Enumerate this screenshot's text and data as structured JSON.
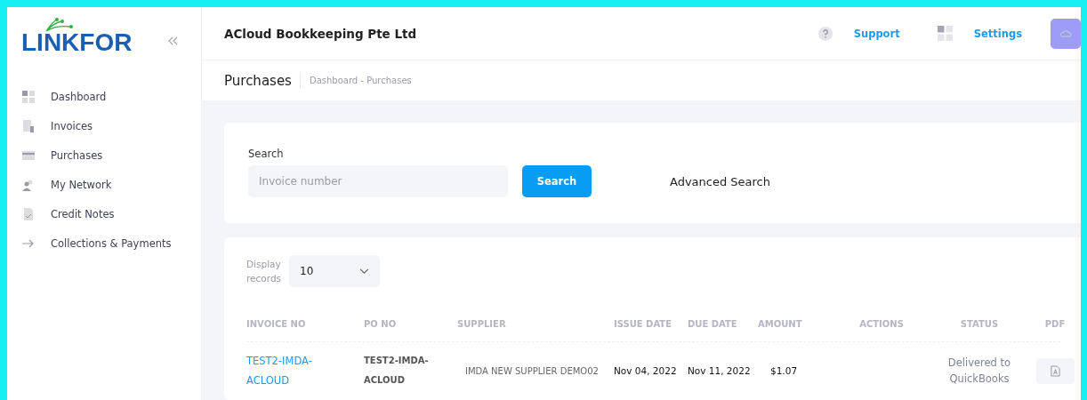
{
  "sidebar": {
    "logo": "LINKFOR",
    "items": [
      {
        "label": "Dashboard",
        "kind": "grid"
      },
      {
        "label": "Invoices",
        "kind": "invoice"
      },
      {
        "label": "Purchases",
        "kind": "card"
      },
      {
        "label": "My Network",
        "kind": "people"
      },
      {
        "label": "Credit Notes",
        "kind": "note"
      },
      {
        "label": "Collections & Payments",
        "kind": "arrow"
      }
    ]
  },
  "header": {
    "company": "ACloud Bookkeeping Pte Ltd",
    "links": [
      {
        "label": "Support",
        "kind": "help"
      },
      {
        "label": "Settings",
        "kind": "grid"
      }
    ]
  },
  "page": {
    "title": "Purchases",
    "breadcrumb": "Dashboard - Purchases"
  },
  "search": {
    "label": "Search",
    "placeholder": "Invoice number",
    "button": "Search",
    "advanced": "Advanced Search"
  },
  "records": {
    "label": "Display records",
    "value": "10"
  },
  "table": {
    "columns": [
      "INVOICE NO",
      "PO NO",
      "SUPPLIER",
      "ISSUE DATE",
      "DUE DATE",
      "AMOUNT",
      "ACTIONS",
      "STATUS",
      "PDF"
    ],
    "rows": [
      {
        "invoice_no": "TEST2-IMDA-ACLOUD",
        "po_no": "TEST2-IMDA-ACLOUD",
        "supplier": "IMDA NEW SUPPLIER DEMO02",
        "issue_date": "Nov 04, 2022",
        "due_date": "Nov 11, 2022",
        "amount": "$1.07",
        "status": "Delivered to QuickBooks"
      }
    ]
  }
}
